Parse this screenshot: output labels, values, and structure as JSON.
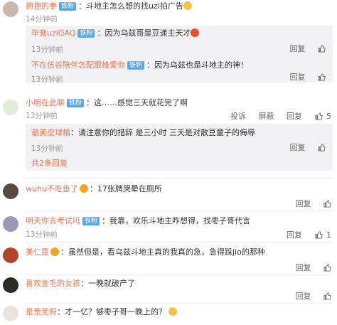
{
  "comments": [
    {
      "user": "拥抱的拳",
      "badge": "铁粉",
      "text": "：斗地主怎么想的找uzi拍广告",
      "time": "14分钟前",
      "likes": ""
    },
    {
      "user": "小明在此聊",
      "badge": "铁粉",
      "text": "：这……感觉三天就花完了啊",
      "time": "13分钟前",
      "likes": "5"
    },
    {
      "user": "wuhu不吃鱼了",
      "badge": "",
      "text": "：17张牌哭晕在厕所",
      "time": "",
      "likes": ""
    },
    {
      "user": "明天你去考试吗",
      "badge": "铁粉",
      "text": "：我靠，欢乐斗地主咋想得，找枣子哥代言",
      "time": "13分钟前",
      "likes": "1"
    },
    {
      "user": "美仁霆",
      "badge": "",
      "text": "：虽然但是，看乌兹斗地主真的我真的急，急得跺jio的那种",
      "time": "",
      "likes": ""
    },
    {
      "user": "喜欢金毛的女孩",
      "badge": "",
      "text": "：一晚就破产了",
      "time": "",
      "likes": ""
    },
    {
      "user": "是荒芜呀",
      "badge": "",
      "text": "：才一亿？够枣子哥一晚上的？",
      "time": "",
      "likes": ""
    }
  ],
  "replies_top": [
    {
      "user": "毕竟uziQAQ",
      "badge": "铁粉",
      "text": "：因为乌兹哥是豆递主天才",
      "time": "13分钟前"
    },
    {
      "user": "不在伍谷陪伴怎配跟峰爱你",
      "badge": "铁粉",
      "text": "：因为乌兹也是斗地主的神！",
      "time": "13分钟前"
    }
  ],
  "replies_mid": [
    {
      "user": "最美皮球精",
      "badge": "",
      "text": "：请注意你的措辞 是三小时 三天是对散豆童子的侮辱",
      "time": "13分钟前"
    }
  ],
  "more_replies": "共2条回复",
  "labels": {
    "reply": "回复",
    "report": "投诉",
    "block": "屏蔽"
  }
}
